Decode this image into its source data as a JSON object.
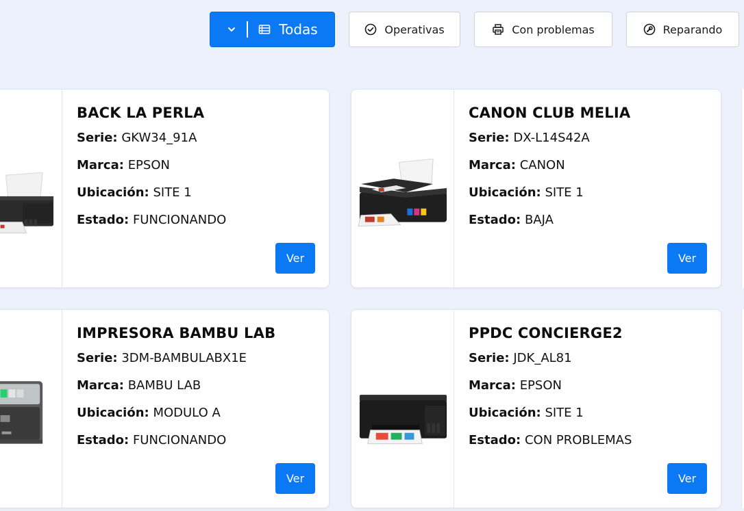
{
  "filters": {
    "todas": "Todas",
    "operativas": "Operativas",
    "con_problemas": "Con problemas",
    "reparando": "Reparando"
  },
  "cards": [
    {
      "title": "BACK LA PERLA",
      "serie_k": "Serie:",
      "serie": "GKW34_91A",
      "marca_k": "Marca:",
      "marca": "EPSON",
      "ubic_k": "Ubicación:",
      "ubic": "SITE 1",
      "estado_k": "Estado:",
      "estado": "FUNCIONANDO",
      "button": "Ver"
    },
    {
      "title": "CANON CLUB MELIA",
      "serie_k": "Serie:",
      "serie": "DX-L14S42A",
      "marca_k": "Marca:",
      "marca": "CANON",
      "ubic_k": "Ubicación:",
      "ubic": "SITE 1",
      "estado_k": "Estado:",
      "estado": "BAJA",
      "button": "Ver"
    },
    {
      "title": "IMPRESORA BAMBU LAB",
      "serie_k": "Serie:",
      "serie": "3DM-BAMBULABX1E",
      "marca_k": "Marca:",
      "marca": "BAMBU LAB",
      "ubic_k": "Ubicación:",
      "ubic": "MODULO A",
      "estado_k": "Estado:",
      "estado": "FUNCIONANDO",
      "button": "Ver"
    },
    {
      "title": "PPDC CONCIERGE2",
      "serie_k": "Serie:",
      "serie": "JDK_AL81",
      "marca_k": "Marca:",
      "marca": "EPSON",
      "ubic_k": "Ubicación:",
      "ubic": "SITE 1",
      "estado_k": "Estado:",
      "estado": "CON PROBLEMAS",
      "button": "Ver"
    }
  ],
  "colors": {
    "accent": "#0b78f4",
    "background": "#edf1fb"
  }
}
